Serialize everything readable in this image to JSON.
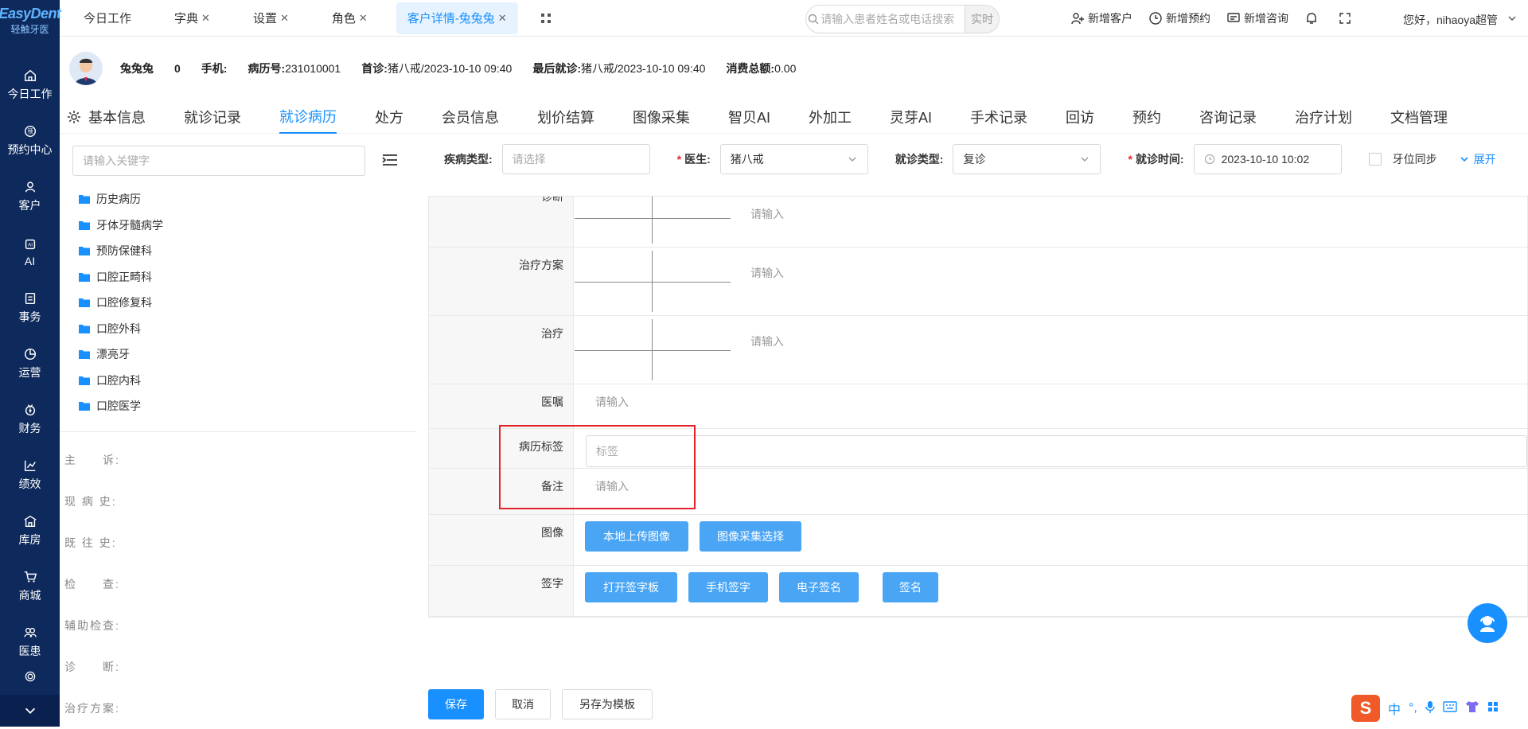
{
  "logo": {
    "brand": "EasyDent",
    "sub": "轻触牙医"
  },
  "nav": [
    {
      "label": "今日工作",
      "icon": "home-icon"
    },
    {
      "label": "预约中心",
      "icon": "appointment-icon"
    },
    {
      "label": "客户",
      "icon": "user-icon"
    },
    {
      "label": "AI",
      "icon": "ai-icon"
    },
    {
      "label": "事务",
      "icon": "task-icon"
    },
    {
      "label": "运营",
      "icon": "pie-icon"
    },
    {
      "label": "财务",
      "icon": "finance-icon"
    },
    {
      "label": "绩效",
      "icon": "chart-icon"
    },
    {
      "label": "库房",
      "icon": "warehouse-icon"
    },
    {
      "label": "商城",
      "icon": "cart-icon"
    },
    {
      "label": "医患",
      "icon": "doctor-patient-icon"
    }
  ],
  "tabs": [
    {
      "label": "今日工作",
      "closable": false
    },
    {
      "label": "字典",
      "closable": true
    },
    {
      "label": "设置",
      "closable": true
    },
    {
      "label": "角色",
      "closable": true
    },
    {
      "label": "客户详情-兔兔兔",
      "closable": true,
      "active": true
    }
  ],
  "search": {
    "placeholder": "请输入患者姓名或电话搜索",
    "mode": "实时"
  },
  "top_actions": [
    "新增客户",
    "新增预约",
    "新增咨询"
  ],
  "greeting": "您好，nihaoya超管",
  "patient": {
    "name": "兔兔兔",
    "count": "0",
    "phone_label": "手机:",
    "record_label": "病历号:",
    "record_no": "231010001",
    "first_visit_label": "首诊:",
    "first_visit": "猪八戒/2023-10-10 09:40",
    "last_visit_label": "最后就诊:",
    "last_visit": "猪八戒/2023-10-10 09:40",
    "total_label": "消费总额:",
    "total": "0.00"
  },
  "patient_tabs": [
    "基本信息",
    "就诊记录",
    "就诊病历",
    "处方",
    "会员信息",
    "划价结算",
    "图像采集",
    "智贝AI",
    "外加工",
    "灵芽AI",
    "手术记录",
    "回访",
    "预约",
    "咨询记录",
    "治疗计划",
    "文档管理"
  ],
  "active_patient_tab": "就诊病历",
  "left": {
    "keyword_placeholder": "请输入关键字",
    "tree": [
      "历史病历",
      "牙体牙髓病学",
      "预防保健科",
      "口腔正畸科",
      "口腔修复科",
      "口腔外科",
      "漂亮牙",
      "口腔内科",
      "口腔医学"
    ],
    "fields": [
      "主　　诉:",
      "现 病 史:",
      "既 往 史:",
      "检　　查:",
      "辅助检查:",
      "诊　　断:",
      "治疗方案:"
    ]
  },
  "filters": {
    "disease_label": "疾病类型:",
    "disease_placeholder": "请选择",
    "doctor_label": "医生:",
    "doctor_value": "猪八戒",
    "visit_type_label": "就诊类型:",
    "visit_type_value": "复诊",
    "visit_time_label": "就诊时间:",
    "visit_time_value": "2023-10-10 10:02",
    "tooth_sync": "牙位同步",
    "expand": "展开"
  },
  "form": {
    "top_cut_label": "诊断",
    "rows": [
      {
        "label": "治疗方案",
        "placeholder": "请输入"
      },
      {
        "label": "治疗",
        "placeholder": "请输入"
      },
      {
        "label": "医嘱",
        "placeholder": "请输入"
      },
      {
        "label": "病历标签",
        "placeholder": "标签"
      },
      {
        "label": "备注",
        "placeholder": "请输入"
      },
      {
        "label": "图像"
      },
      {
        "label": "签字"
      }
    ],
    "diag_placeholder": "请输入",
    "image_buttons": [
      "本地上传图像",
      "图像采集选择"
    ],
    "sign_buttons": [
      "打开签字板",
      "手机签字",
      "电子签名",
      "签名"
    ]
  },
  "bottom_buttons": [
    "保存",
    "取消",
    "另存为模板"
  ],
  "ime": {
    "logo": "S",
    "lang": "中"
  },
  "colors": {
    "sidebar": "#0e2a5c",
    "accent": "#1890ff",
    "button": "#4aa5f5",
    "highlight": "#e2232b"
  }
}
